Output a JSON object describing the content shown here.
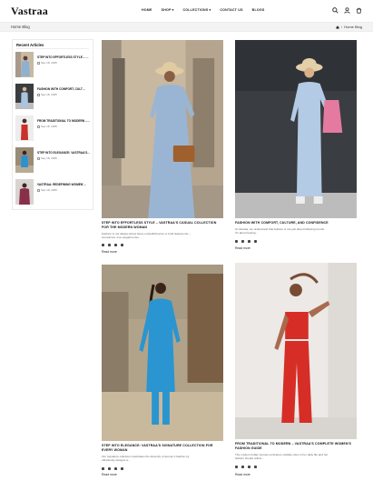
{
  "header": {
    "logo": "Vastraa",
    "nav": [
      {
        "label": "HOME",
        "caret": ""
      },
      {
        "label": "SHOP",
        "caret": "▾"
      },
      {
        "label": "COLLECTIONS",
        "caret": "▾"
      },
      {
        "label": "CONTACT US",
        "caret": ""
      },
      {
        "label": "BLOGS",
        "caret": ""
      }
    ],
    "icons": [
      "search-icon",
      "user-icon",
      "cart-icon"
    ]
  },
  "breadcrumb": {
    "title": "Home Blog",
    "home_icon": "home-icon",
    "separator": "›",
    "current": "Home Blog"
  },
  "sidebar": {
    "title": "Recent Articles",
    "items": [
      {
        "title": "STEP INTO EFFORTLESS STYLE – …",
        "date": "Sep 18, 2025"
      },
      {
        "title": "FASHION WITH COMFORT, CULT…",
        "date": "Sep 18, 2025"
      },
      {
        "title": "FROM TRADITIONAL TO MODERN –…",
        "date": "Sep 18, 2025"
      },
      {
        "title": "STEP INTO ELEGANCE: VASTRAA'S…",
        "date": "Sep 18, 2025"
      },
      {
        "title": "VASTRAA: REDEFINING WOMEN'…",
        "date": "Sep 18, 2025"
      }
    ]
  },
  "articles": [
    {
      "title": "STEP INTO EFFORTLESS STYLE – VASTRAA'S CASUAL COLLECTION FOR THE MODERN WOMAN",
      "excerpt": "Fashion is not always about fancy embellishments or bold statements—",
      "excerpt2": "sometimes, true elegance lies...",
      "read_more": "Read more"
    },
    {
      "title": "FASHION WITH COMFORT, CULTURE, AND CONFIDENCE",
      "excerpt": "At Vastraa, we understand that fashion is not just about following trends.",
      "excerpt2": "It's about feeling...",
      "read_more": "Read more"
    },
    {
      "title": "STEP INTO ELEGANCE: VASTRAA'S SIGNATURE COLLECTION FOR EVERY WOMAN",
      "excerpt": "Our signature collection celebrates the diversity of women's fashion by",
      "excerpt2": "effortlessly designs a...",
      "read_more": "Read more"
    },
    {
      "title": "FROM TRADITIONAL TO MODERN – VASTRAA'S COMPLETE WOMEN'S FASHION GUIDE",
      "excerpt": "The modern Indian woman embraces multiple roles in her daily life and her",
      "excerpt2": "fashion should reflect...",
      "read_more": "Read more"
    }
  ],
  "social_icons": [
    "facebook-icon",
    "instagram-icon",
    "pinterest-icon",
    "linkedin-icon"
  ]
}
